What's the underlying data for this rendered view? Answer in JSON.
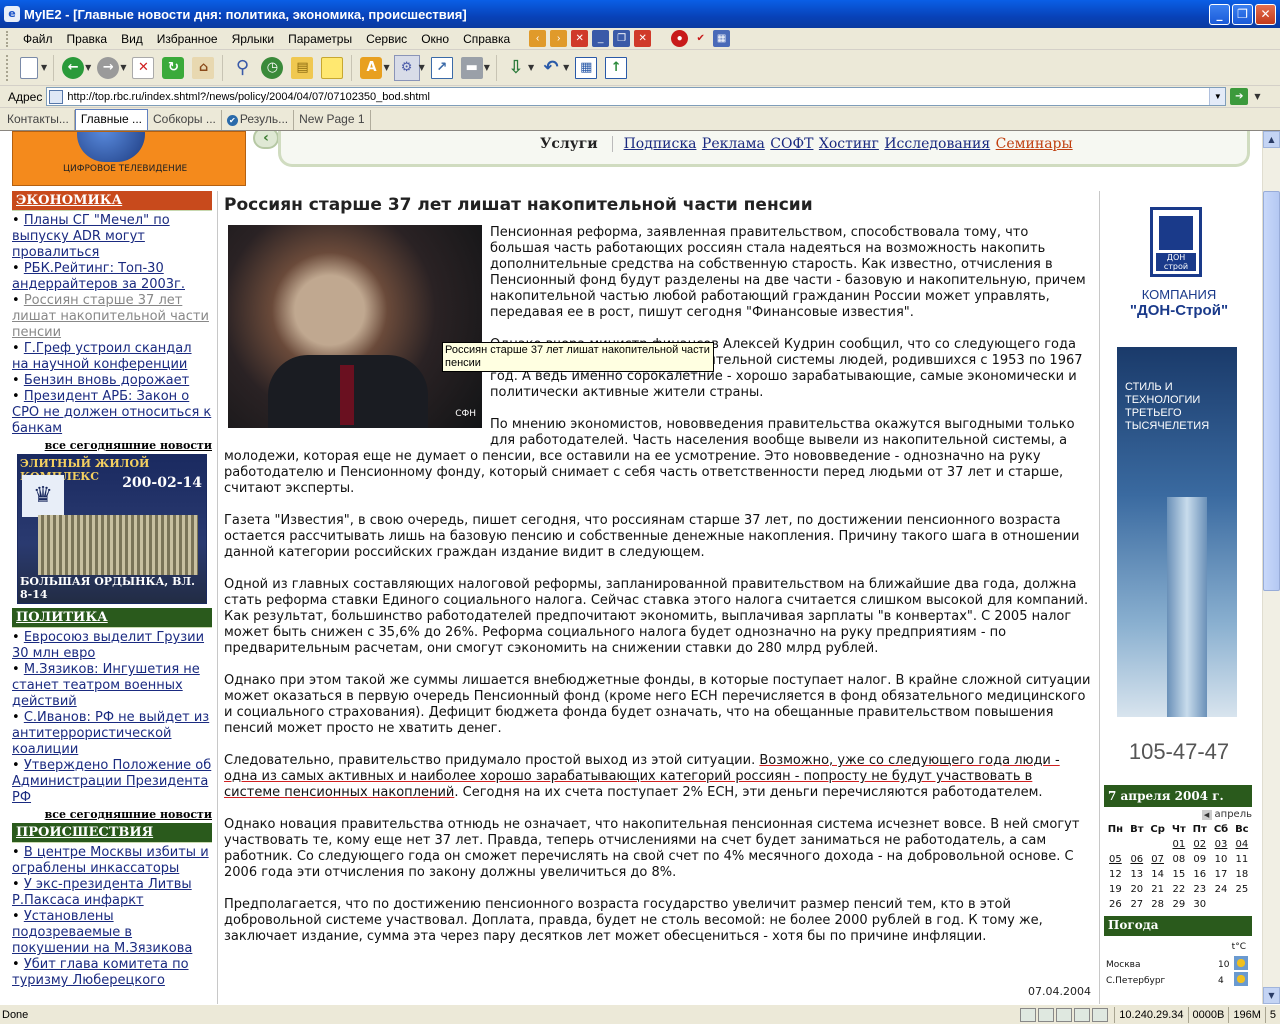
{
  "window": {
    "title": "MyIE2 - [Главные новости дня: политика, экономика, происшествия]",
    "controls": [
      "_",
      "❐",
      "✕"
    ]
  },
  "menu": {
    "items": [
      "Файл",
      "Правка",
      "Вид",
      "Избранное",
      "Ярлыки",
      "Параметры",
      "Сервис",
      "Окно",
      "Справка"
    ]
  },
  "address": {
    "label": "Адрес",
    "url": "http://top.rbc.ru/index.shtml?/news/policy/2004/04/07/07102350_bod.shtml"
  },
  "tabs": [
    {
      "label": "Контакты..."
    },
    {
      "label": "Главные ..."
    },
    {
      "label": "Собкоры ..."
    },
    {
      "label": "Резуль..."
    },
    {
      "label": "New Page 1"
    }
  ],
  "services": {
    "label": "Услуги",
    "links": [
      "Подписка",
      "Реклама",
      "СОФТ",
      "Хостинг",
      "Исследования",
      "Семинары"
    ]
  },
  "logo": {
    "caption": "ЦИФРОВОЕ ТЕЛЕВИДЕНИЕ"
  },
  "left": {
    "economy": {
      "title": "ЭКОНОМИКА",
      "items": [
        "Планы СГ \"Мечел\" по выпуску ADR могут провалиться",
        "РБК.Рейтинг: Топ-30 андеррайтеров за 2003г.",
        "Россиян старше 37 лет лишат накопительной части пенсии",
        "Г.Греф устроил скандал на научной конференции",
        "Бензин вновь дорожает",
        "Президент АРБ: Закон о СРО не должен относиться к банкам"
      ],
      "all": "все сегодняшние новости"
    },
    "ad": {
      "line1": "ЭЛИТНЫЙ ЖИЛОЙ КОМПЛЕКС",
      "phone": "200-02-14",
      "address": "БОЛЬШАЯ ОРДЫНКА, ВЛ. 8-14"
    },
    "politics": {
      "title": "ПОЛИТИКА",
      "items": [
        "Евросоюз выделит Грузии 30 млн евро",
        "М.Зязиков: Ингушетия не станет театром военных действий",
        "С.Иванов: РФ не выйдет из антитеррористической коалиции",
        "Утверждено Положение об Администрации Президента РФ"
      ],
      "all": "все сегодняшние новости"
    },
    "incidents": {
      "title": "ПРОИСШЕСТВИЯ",
      "items": [
        "В центре Москвы избиты и ограблены инкассаторы",
        "У экс-президента Литвы Р.Паксаса инфаркт",
        "Установлены подозреваемые в покушении на М.Зязикова",
        "Убит глава комитета по туризму Люберецкого"
      ]
    }
  },
  "article": {
    "title": "Россиян старше 37 лет лишат накопительной части пенсии",
    "photo_credit": "СФН",
    "tooltip": "Россиян старше 37 лет лишат накопительной части пенсии",
    "p1": "Пенсионная реформа, заявленная правительством, способствовала тому, что большая часть работающих россиян стала надеяться на возможность накопить дополнительные средства на собственную старость. Как известно, отчисления в Пенсионный фонд будут разделены на две части - базовую и накопительную, причем накопительной частью любой работающий гражданин России может управлять, передавая ее в рост, пишут сегодня \"Финансовые известия\".",
    "p2": "Однако вчера министр финансов Алексей Кудрин сообщил, что со следующего года правительство отсечь от накопительной системы людей, родившихся с 1953 по 1967 год. А ведь именно сорокалетние - хорошо зарабатывающие, самые экономически и политически активные жители страны.",
    "p3": "По мнению экономистов, нововведения правительства окажутся выгодными только для работодателей. Часть населения вообще вывели из накопительной системы, а молодежи, которая еще не думает о пенсии, все оставили на ее усмотрение. Это нововведение - однозначно на руку работодателю и Пенсионному фонду, который снимает с себя часть ответственности перед людьми от 37 лет и старше, считают эксперты.",
    "p4": "Газета \"Известия\", в свою очередь, пишет сегодня, что россиянам старше 37 лет, по достижении пенсионного возраста остается рассчитывать лишь на базовую пенсию и собственные денежные накопления. Причину такого шага в отношении данной категории российских граждан издание видит в следующем.",
    "p5": "Одной из главных составляющих налоговой реформы, запланированной правительством на ближайшие два года, должна стать реформа ставки Единого социального налога. Сейчас ставка этого налога считается слишком высокой для компаний. Как результат, большинство работодателей предпочитают экономить, выплачивая зарплаты \"в конвертах\". С 2005 налог может быть снижен с 35,6% до 26%. Реформа социального налога будет однозначно на руку предприятиям - по предварительным расчетам, они смогут сэкономить на снижении ставки до 280 млрд рублей.",
    "p6": "Однако при этом такой же суммы лишается внебюджетные фонды, в которые поступает налог. В крайне сложной ситуации может оказаться в первую очередь Пенсионный фонд (кроме него ЕСН перечисляется в фонд обязательного медицинского и социального страхования). Дефицит бюджета фонда будет означать, что на обещанные правительством повышения пенсий может просто не хватить денег.",
    "p7a": "Следовательно, правительство придумало простой выход из этой ситуации. ",
    "p7b": "Возможно, уже со следующего года люди - одна из самых активных и наиболее хорошо зарабатывающих категорий россиян - попросту не будут участвовать в системе пенсионных накоплений",
    "p7c": ". Сегодня на их счета поступает 2% ЕСН, эти деньги перечисляются работодателем.",
    "p8": "Однако новация правительства отнюдь не означает, что накопительная пенсионная система исчезнет вовсе. В ней смогут участвовать те, кому еще нет 37 лет. Правда, теперь отчислениями на счет будет заниматься не работодатель, а сам работник. Со следующего года он сможет перечислять на свой счет по 4% месячного дохода - на добровольной основе. С 2006 года эти отчисления по закону должны увеличиться до 8%.",
    "p9": "Предполагается, что по достижению пенсионного возраста государство увеличит размер пенсий тем, кто в этой добровольной системе участвовал. Доплата, правда, будет не столь весомой: не более 2000 рублей в год. К тому же, заключает издание, сумма эта через пару десятков лет может обесцениться - хотя бы по причине инфляции.",
    "date": "07.04.2004"
  },
  "right": {
    "logo_text": "ДОН строй",
    "company_line1": "КОМПАНИЯ",
    "company_line2": "\"ДОН-Строй\"",
    "slogan": "СТИЛЬ И ТЕХНОЛОГИИ ТРЕТЬЕГО ТЫСЯЧЕЛЕТИЯ",
    "phone": "105-47-47"
  },
  "calendar": {
    "title": "7 апреля 2004 г.",
    "nav": "апрель",
    "weekdays": [
      "Пн",
      "Вт",
      "Ср",
      "Чт",
      "Пт",
      "Сб",
      "Вс"
    ],
    "weeks": [
      [
        "",
        "",
        "",
        "01",
        "02",
        "03",
        "04"
      ],
      [
        "05",
        "06",
        "07",
        "08",
        "09",
        "10",
        "11"
      ],
      [
        "12",
        "13",
        "14",
        "15",
        "16",
        "17",
        "18"
      ],
      [
        "19",
        "20",
        "21",
        "22",
        "23",
        "24",
        "25"
      ],
      [
        "26",
        "27",
        "28",
        "29",
        "30",
        "",
        ""
      ]
    ]
  },
  "weather": {
    "title": "Погода",
    "unit": "t°C",
    "rows": [
      {
        "city": "Москва",
        "temp": "10"
      },
      {
        "city": "С.Петербург",
        "temp": "4"
      }
    ]
  },
  "status": {
    "text": "Done",
    "ip": "10.240.29.34",
    "bytes": "0000B",
    "mem": "196M",
    "num": "5"
  }
}
